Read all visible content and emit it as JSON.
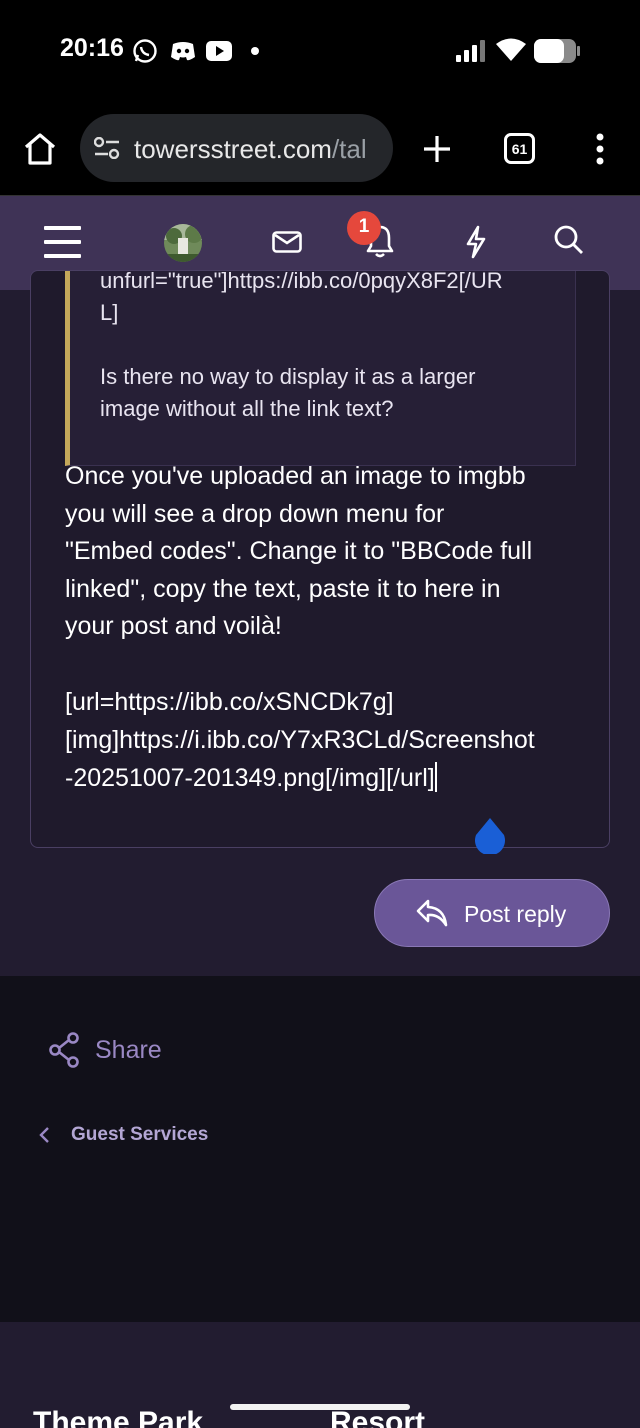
{
  "status_bar": {
    "time": "20:16",
    "icons": [
      "whatsapp-icon",
      "discord-icon",
      "youtube-icon",
      "dot-icon",
      "signal-icon",
      "wifi-icon",
      "battery-icon"
    ]
  },
  "browser": {
    "url_host": "towersstreet.com",
    "url_path": "/tal",
    "tab_count": "61"
  },
  "forum_nav": {
    "notification_count": "1",
    "icons": [
      "menu-icon",
      "avatar",
      "mail-icon",
      "bell-icon",
      "lightning-icon",
      "search-icon"
    ]
  },
  "quote": {
    "line1": "unfurl=\"true\"]https://ibb.co/0pqyX8F2[/UR",
    "line2": "L]",
    "line3": "Is there no way to display it as a larger",
    "line4": "image without all the link text?"
  },
  "editor": {
    "body_lines": [
      "Once you've uploaded an image to imgbb",
      "you will see a drop down menu for",
      "\"Embed codes\". Change it to \"BBCode full",
      "linked\", copy the text, paste it to here in",
      "your post and voilà!"
    ],
    "code_lines": [
      "[url=https://ibb.co/xSNCDk7g]",
      "[img]https://i.ibb.co/Y7xR3CLd/Screenshot",
      "-20251007-201349.png[/img][/url]"
    ]
  },
  "actions": {
    "post_reply_label": "Post reply",
    "share_label": "Share",
    "breadcrumb_label": "Guest Services"
  },
  "footer": {
    "left_text": "Theme Park",
    "right_text": "Resort"
  },
  "colors": {
    "nav_bg": "#3f3356",
    "content_bg": "#221c30",
    "accent": "#6a5698",
    "quote_border": "#c4a85a",
    "badge": "#e5483c",
    "link": "#9a88c4"
  }
}
